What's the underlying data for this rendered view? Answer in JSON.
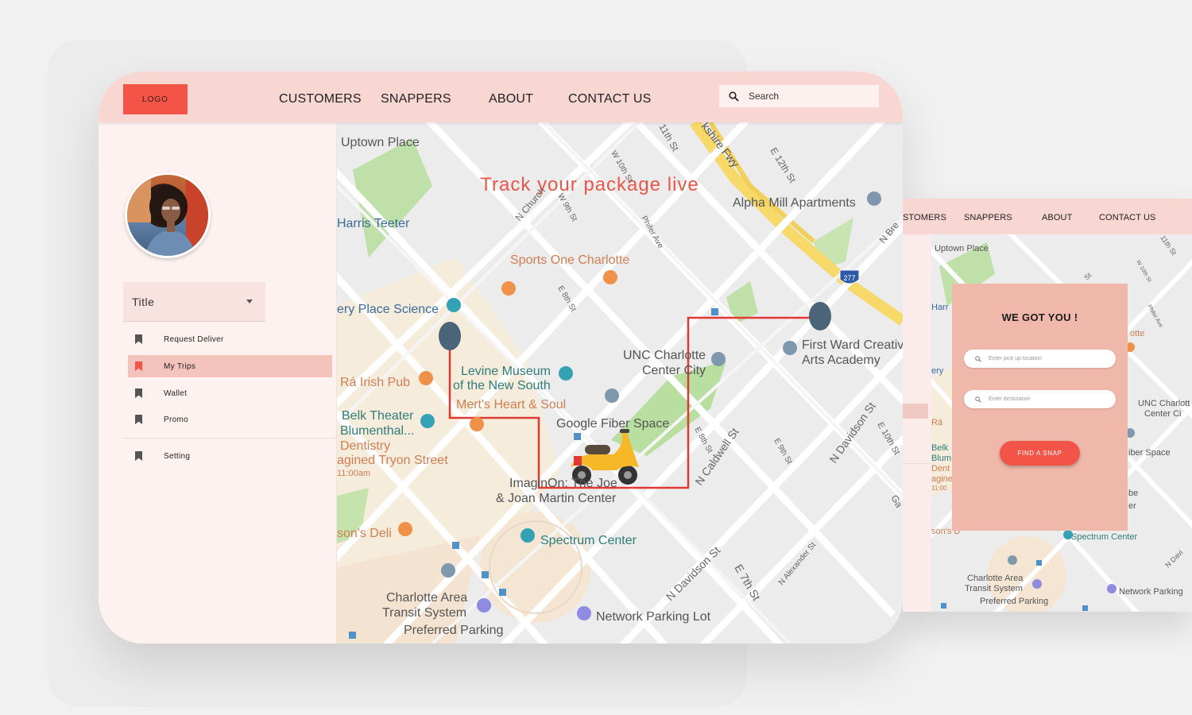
{
  "header": {
    "logo": "LOGO",
    "nav": [
      "CUSTOMERS",
      "SNAPPERS",
      "ABOUT",
      "CONTACT US"
    ],
    "search_placeholder": "Search"
  },
  "sidebar": {
    "title_select": "Title",
    "items": [
      {
        "label": "Request Deliver",
        "active": false
      },
      {
        "label": "My Trips",
        "active": true
      },
      {
        "label": "Wallet",
        "active": false
      },
      {
        "label": "Promo",
        "active": false
      },
      {
        "label": "Setting",
        "active": false
      }
    ]
  },
  "map": {
    "headline": "Track your package live",
    "labels": {
      "uptown_place": "Uptown Place",
      "harris_teeter": "Harris Teeter",
      "sports_one": "Sports One Charlotte",
      "alpha_mill": "Alpha Mill Apartments",
      "discovery": "ery Place Science",
      "unc1": "UNC Charlotte",
      "unc2": "Center City",
      "first_ward1": "First Ward Creativ",
      "first_ward2": "Arts Academy",
      "levine1": "Levine Museum",
      "levine2": "of the New South",
      "merts": "Mert's Heart & Soul",
      "irish_pub": "Rá Irish Pub",
      "belk1": "Belk Theater",
      "belk2": "Blumenthal...",
      "belk3": "Dentistry",
      "imagined": "agined Tryon Street",
      "imagined_time": "11:00am",
      "google_fiber": "Google Fiber Space",
      "imaginon1": "ImaginOn: The Joe",
      "imaginon2": "& Joan Martin Center",
      "spectrum": "Spectrum Center",
      "deli": "son's Deli",
      "catsys1": "Charlotte Area",
      "catsys2": "Transit System",
      "catsys3": "Preferred Parking",
      "network_parking": "Network Parking Lot",
      "st_11th": "11th St",
      "st_12th": "E 12th St",
      "brookshire": "kshire Fwy",
      "n_church": "N Church",
      "w10th": "W 10th St",
      "w9th": "W 9th St",
      "phifer": "Phifer Ave",
      "e8th": "E 8th St",
      "n_brevard": "N Bre",
      "interstate": "277",
      "n_caldwell": "N Caldwell St",
      "e9th": "E 9th St",
      "n_davidson1": "N Davidson St",
      "e10th": "E 10th St",
      "e8th_b": "E 8th St",
      "n_davidson2": "N Davidson St",
      "e7th": "E 7th St",
      "n_alexander": "N Alexander St",
      "ga": "Ga"
    }
  },
  "mobile": {
    "nav": [
      "STOMERS",
      "SNAPPERS",
      "ABOUT",
      "CONTACT US"
    ],
    "card_title": "WE GOT YOU !",
    "pickup_placeholder": "Enter pick up location",
    "destination_placeholder": "Enter destination",
    "find_button": "FIND A SNAP",
    "labels": {
      "uptown": "Uptown Place",
      "harr": "Harr",
      "ery": "ery",
      "ra": "Rá",
      "belk": "Belk",
      "blum": "Blum",
      "dent": "Dent",
      "agine": "agine",
      "time": "11:00",
      "sons": "son's D",
      "otte": "otte",
      "unc1": "UNC Charlott",
      "unc2": "Center Ci",
      "fiber": "iber Space",
      "be": "be",
      "er": "er",
      "spectrum": "Spectrum Center",
      "cat1": "Charlotte Area",
      "cat2": "Transit System",
      "cat3": "Preferred Parking",
      "network": "Network Parking",
      "st11": "11th St",
      "w10": "W 10th St",
      "st": "St",
      "phifer": "Phifer Ave",
      "ndav": "N Davi"
    }
  },
  "colors": {
    "accent": "#f25548",
    "header": "#f8d7d3",
    "sidebar": "#fdf2f0",
    "route": "#e03a33",
    "pin": "#4b6479",
    "card": "#efb8ab"
  },
  "icons": {
    "search": "magnifier-icon",
    "menu": "bookmark-icon",
    "vehicle": "scooter-icon"
  }
}
